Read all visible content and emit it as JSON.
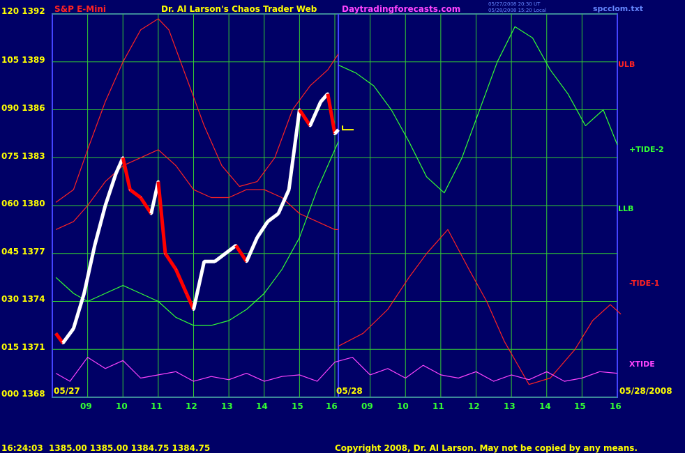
{
  "header": {
    "left": "S&P E-Mini",
    "title": "Dr. Al Larson's Chaos Trader Web",
    "site": "Daytradingforecasts.com",
    "stamp1": "05/27/2008 20:30 UT",
    "stamp2": "05/28/2008 15:20 Local",
    "file": "spcclom.txt"
  },
  "y_axis_labels": [
    "120 1392",
    "105 1389",
    "090 1386",
    "075 1383",
    "060 1380",
    "045 1377",
    "030 1374",
    "015 1371",
    "000 1368"
  ],
  "x_axis_labels": [
    "09",
    "10",
    "11",
    "12",
    "13",
    "14",
    "15",
    "16",
    "09",
    "10",
    "11",
    "12",
    "13",
    "14",
    "15",
    "16"
  ],
  "date_labels": {
    "start": "05/27",
    "mid": "05/28",
    "end": "05/28/2008"
  },
  "right_labels": {
    "ulb": "ULB",
    "tide2": "+TIDE-2",
    "llb": "LLB",
    "tide1": "-TIDE-1",
    "xtide": "XTIDE"
  },
  "footer": {
    "quote": "16:24:03  1385.00 1385.00 1384.75 1384.75",
    "copyright": "Copyright 2008, Dr. Al Larson. May not be copied by any means."
  },
  "colors": {
    "background": "#000066",
    "grid": "#33cc33",
    "price_up": "#ffffff",
    "price_down": "#ff0000",
    "ulb": "#ff2222",
    "tide2": "#33ff33",
    "llb": "#33ff33",
    "tide1": "#ff2222",
    "xtide": "#ff44ff",
    "frame": "#4444ff"
  },
  "chart_data": {
    "type": "line",
    "title": "S&P E-Mini",
    "ylim": [
      1368,
      1392
    ],
    "y_ticks": [
      1368,
      1371,
      1374,
      1377,
      1380,
      1383,
      1386,
      1389,
      1392
    ],
    "x_sessions": [
      "05/27",
      "05/28"
    ],
    "series": [
      {
        "name": "ULB",
        "hours": [
          8.1,
          8.6,
          9.0,
          9.5,
          10.0,
          10.5,
          11.0,
          11.3,
          11.8,
          12.3,
          12.8,
          13.3,
          13.8,
          14.3,
          14.8,
          15.3,
          15.8,
          16.1
        ],
        "values": [
          1380.2,
          1381.0,
          1383.5,
          1386.5,
          1389.0,
          1391.0,
          1391.7,
          1391.0,
          1388.0,
          1385.0,
          1382.5,
          1381.2,
          1381.5,
          1383.0,
          1386.0,
          1387.5,
          1388.5,
          1389.5
        ]
      },
      {
        "name": "-TIDE-1 (day 1)",
        "hours": [
          8.1,
          8.6,
          9.0,
          9.5,
          10.0,
          10.5,
          11.0,
          11.5,
          12.0,
          12.5,
          13.0,
          13.5,
          14.0,
          14.5,
          15.0,
          15.5,
          16.0,
          16.1
        ],
        "values": [
          1378.5,
          1379.0,
          1380.0,
          1381.5,
          1382.5,
          1383.0,
          1383.5,
          1382.5,
          1381.0,
          1380.5,
          1380.5,
          1381.0,
          1381.0,
          1380.5,
          1379.5,
          1379.0,
          1378.5,
          1378.5
        ]
      },
      {
        "name": "-TIDE-1",
        "hours": [
          16.1,
          16.8,
          17.5,
          18.1,
          18.6,
          19.2,
          19.8,
          20.3,
          20.8,
          21.5,
          22.1,
          22.8,
          23.3,
          23.8,
          24.1
        ],
        "values": [
          1371.2,
          1372.0,
          1373.5,
          1375.5,
          1377.0,
          1378.5,
          1376.0,
          1374.0,
          1371.5,
          1368.8,
          1369.2,
          1371.0,
          1372.8,
          1373.8,
          1373.2
        ]
      },
      {
        "name": "+TIDE-2",
        "hours": [
          16.1,
          16.6,
          17.1,
          17.6,
          18.1,
          18.6,
          19.1,
          19.6,
          20.1,
          20.6,
          21.1,
          21.6,
          22.1,
          22.6,
          23.1,
          23.6,
          24.0
        ],
        "values": [
          1388.8,
          1388.3,
          1387.5,
          1386.0,
          1384.0,
          1381.8,
          1380.8,
          1383.0,
          1386.0,
          1389.0,
          1391.2,
          1390.5,
          1388.5,
          1387.0,
          1385.0,
          1386.0,
          1383.8
        ]
      },
      {
        "name": "LLB",
        "hours": [
          8.1,
          8.6,
          9.0,
          9.5,
          10.0,
          10.5,
          11.0,
          11.5,
          12.0,
          12.5,
          13.0,
          13.5,
          14.0,
          14.5,
          15.0,
          15.5,
          16.0,
          16.1
        ],
        "values": [
          1375.5,
          1374.5,
          1374.0,
          1374.5,
          1375.0,
          1374.5,
          1374.0,
          1373.0,
          1372.5,
          1372.5,
          1372.8,
          1373.5,
          1374.5,
          1376.0,
          1378.0,
          1381.0,
          1383.5,
          1384.0
        ]
      },
      {
        "name": "XTIDE",
        "hours": [
          8.1,
          8.5,
          9.0,
          9.5,
          10.0,
          10.5,
          11.0,
          11.5,
          12.0,
          12.5,
          13.0,
          13.5,
          14.0,
          14.5,
          15.0,
          15.5,
          16.0,
          16.5,
          17.0,
          17.5,
          18.0,
          18.5,
          19.0,
          19.5,
          20.0,
          20.5,
          21.0,
          21.5,
          22.0,
          22.5,
          23.0,
          23.5,
          24.0
        ],
        "values": [
          1369.5,
          1369.0,
          1370.5,
          1369.8,
          1370.3,
          1369.2,
          1369.4,
          1369.6,
          1369.0,
          1369.3,
          1369.1,
          1369.5,
          1369.0,
          1369.3,
          1369.4,
          1369.0,
          1370.2,
          1370.5,
          1369.4,
          1369.8,
          1369.2,
          1370.0,
          1369.4,
          1369.2,
          1369.6,
          1369.0,
          1369.4,
          1369.1,
          1369.6,
          1369.0,
          1369.2,
          1369.6,
          1369.5
        ]
      },
      {
        "name": "Price",
        "hours": [
          8.1,
          8.3,
          8.6,
          8.9,
          9.2,
          9.5,
          9.8,
          10.0,
          10.2,
          10.5,
          10.8,
          11.0,
          11.2,
          11.5,
          11.8,
          12.0,
          12.3,
          12.6,
          12.9,
          13.2,
          13.5,
          13.8,
          14.1,
          14.4,
          14.7,
          15.0,
          15.3,
          15.6,
          15.8,
          16.0,
          16.1
        ],
        "values": [
          1372.0,
          1371.4,
          1372.3,
          1374.5,
          1377.5,
          1380.0,
          1382.0,
          1383.0,
          1381.0,
          1380.5,
          1379.5,
          1381.5,
          1377.0,
          1376.0,
          1374.5,
          1373.5,
          1376.5,
          1376.5,
          1377.0,
          1377.5,
          1376.5,
          1378.0,
          1379.0,
          1379.5,
          1381.0,
          1386.0,
          1385.0,
          1386.5,
          1387.0,
          1384.5,
          1384.75
        ]
      }
    ]
  }
}
